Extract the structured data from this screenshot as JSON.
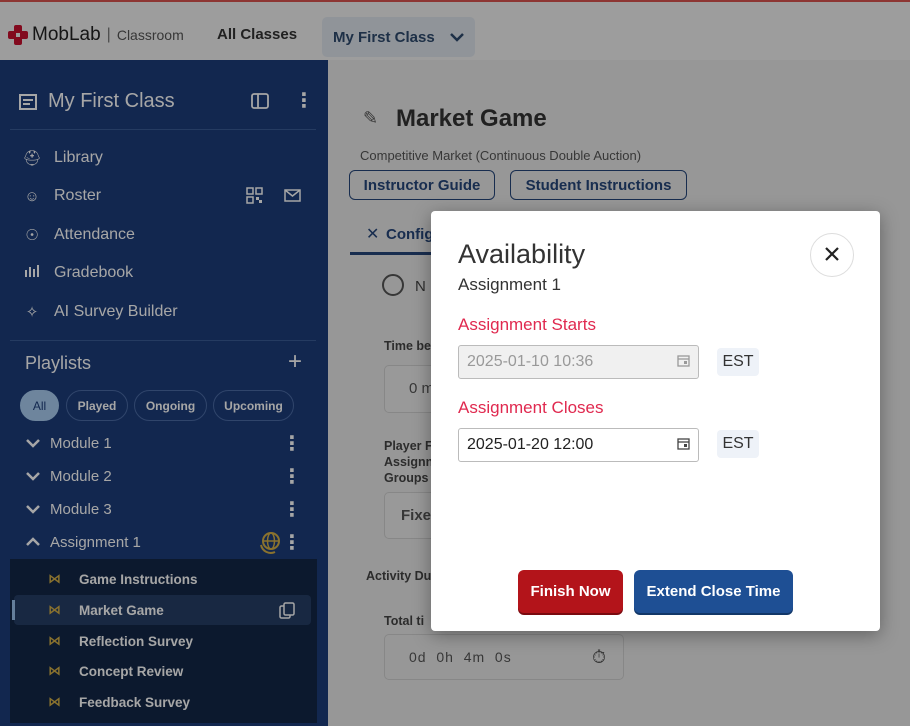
{
  "topbar": {
    "brand": "MobLab",
    "brand_sub": "Classroom",
    "all_classes": "All Classes",
    "current_class": "My First Class"
  },
  "sidebar": {
    "class_title": "My First Class",
    "nav": [
      {
        "label": "Library",
        "icon": "library-icon"
      },
      {
        "label": "Roster",
        "icon": "roster-icon"
      },
      {
        "label": "Attendance",
        "icon": "attendance-icon"
      },
      {
        "label": "Gradebook",
        "icon": "gradebook-icon"
      },
      {
        "label": "AI Survey Builder",
        "icon": "sparkle-icon"
      }
    ],
    "playlists_title": "Playlists",
    "filters": [
      "All",
      "Played",
      "Ongoing",
      "Upcoming"
    ],
    "active_filter": "All",
    "modules": [
      "Module 1",
      "Module 2",
      "Module 3",
      "Assignment 1"
    ],
    "assignment_items": [
      "Game Instructions",
      "Market Game",
      "Reflection Survey",
      "Concept Review",
      "Feedback Survey"
    ],
    "active_item": "Market Game"
  },
  "main": {
    "title": "Market Game",
    "subtitle": "Competitive Market (Continuous Double Auction)",
    "instructor_guide": "Instructor Guide",
    "student_instructions": "Student Instructions",
    "tab": "Config",
    "partial": {
      "radio_text": "N",
      "time_label": "Time be",
      "zero_value": "0 m",
      "player_label": "Player F",
      "assign_label": "Assignn",
      "groups_label": "Groups",
      "fixed_value": "Fixe",
      "activity_label": "Activity Du",
      "total_label": "Total ti"
    },
    "timer": "0d  0h  4m  0s"
  },
  "modal": {
    "title": "Availability",
    "subtitle": "Assignment 1",
    "starts_label": "Assignment Starts",
    "starts_value": "2025-01-10 10:36",
    "closes_label": "Assignment Closes",
    "closes_value": "2025-01-20 12:00",
    "timezone": "EST",
    "finish_label": "Finish Now",
    "extend_label": "Extend Close Time"
  }
}
